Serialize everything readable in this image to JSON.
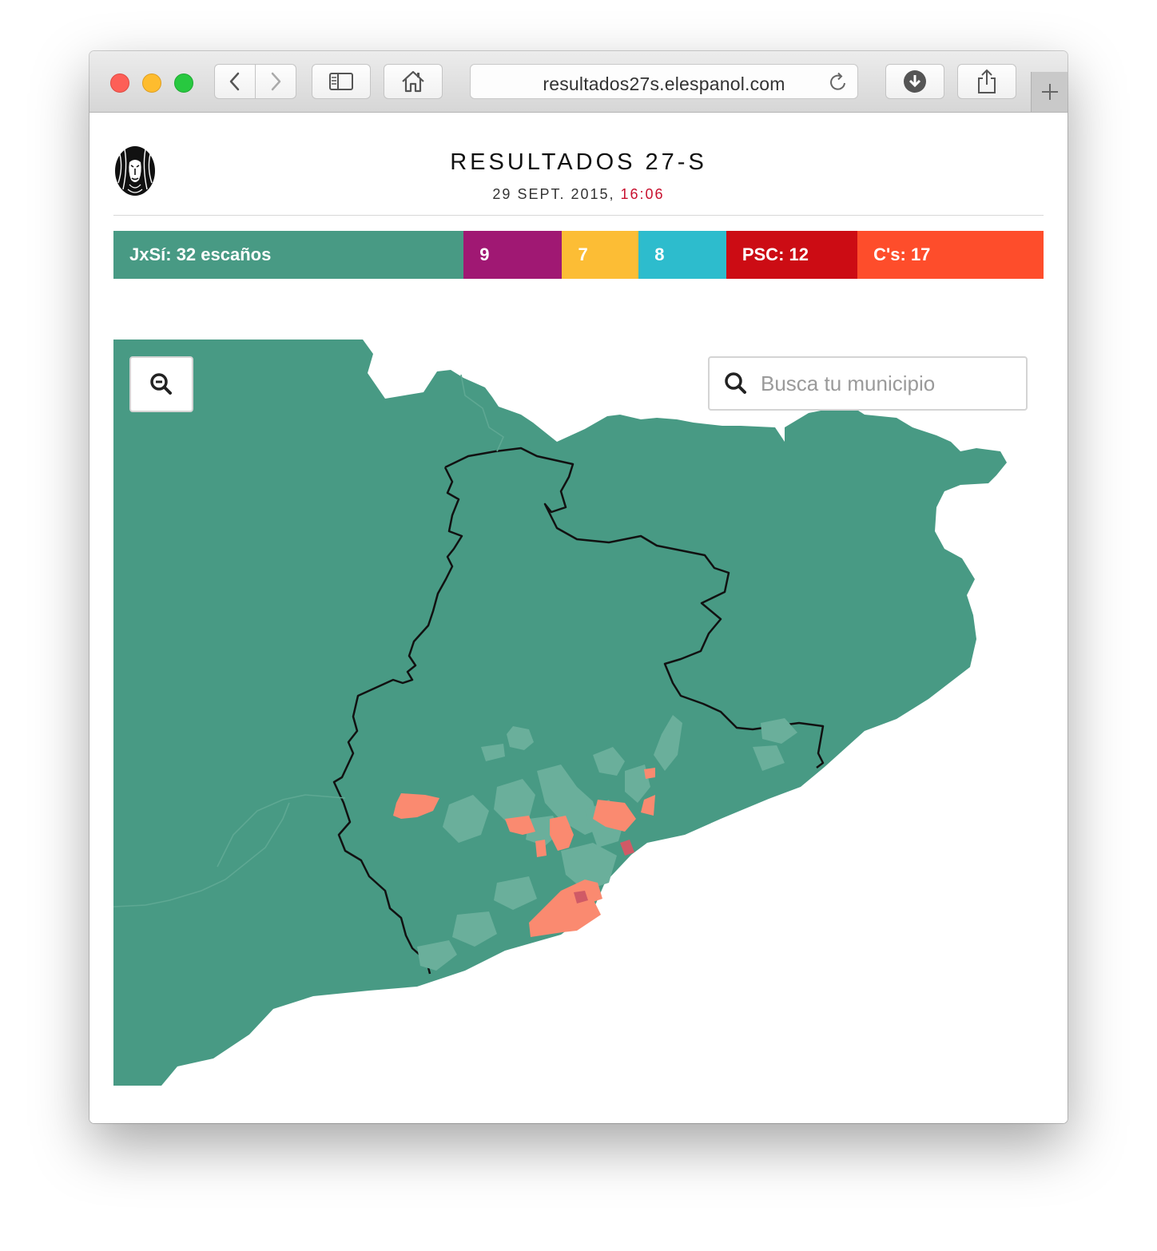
{
  "browser": {
    "url": "resultados27s.elespanol.com",
    "buttons": {
      "back": "back",
      "forward": "forward",
      "sidebar": "sidebar",
      "home": "home",
      "downloads": "downloads",
      "share": "share",
      "new_tab": "new tab"
    }
  },
  "header": {
    "title": "RESULTADOS 27-S",
    "date": "29 SEPT. 2015, ",
    "time": "16:06"
  },
  "seats": [
    {
      "label": "JxSí: 32 escaños",
      "seats": 32,
      "color": "#489a84"
    },
    {
      "label": "9",
      "seats": 9,
      "color": "#a01873"
    },
    {
      "label": "7",
      "seats": 7,
      "color": "#fcbd35"
    },
    {
      "label": "8",
      "seats": 8,
      "color": "#2dbccd"
    },
    {
      "label": "PSC: 12",
      "seats": 12,
      "color": "#cc0c14"
    },
    {
      "label": "C's: 17",
      "seats": 17,
      "color": "#fe4d2b"
    }
  ],
  "map": {
    "search_placeholder": "Busca tu municipio",
    "colors": {
      "jxsi": "#489a84",
      "jxsi_light": "#6aaf9b",
      "cs": "#fa8a70",
      "psc": "#d05a66",
      "border": "#111111"
    }
  }
}
